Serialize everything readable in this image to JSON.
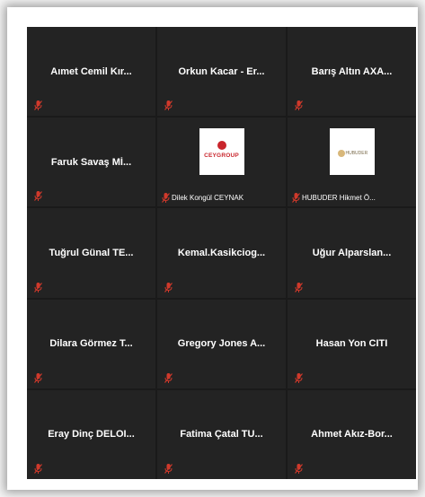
{
  "tiles": [
    {
      "name": "Aımet Cemil Kır..."
    },
    {
      "name": "Orkun Kacar - Er..."
    },
    {
      "name": "Barış Altın AXA..."
    },
    {
      "name": "Faruk Savaş Mİ..."
    },
    {
      "video_label": "Dilek Kongül CEYNAK",
      "logo": "CEYGROUP"
    },
    {
      "video_label": "HUBUDER Hikmet Ö...",
      "logo": "HUBUDER"
    },
    {
      "name": "Tuğrul Günal TE..."
    },
    {
      "name": "Kemal.Kasikciog..."
    },
    {
      "name": "Uğur Alparslan..."
    },
    {
      "name": "Dilara Görmez T..."
    },
    {
      "name": "Gregory Jones A..."
    },
    {
      "name": "Hasan Yon CITI"
    },
    {
      "name": "Eray Dinç DELOI..."
    },
    {
      "name": "Fatima Çatal TU..."
    },
    {
      "name": "Ahmet Akız-Bor..."
    }
  ],
  "colors": {
    "tile_bg": "#232323",
    "mute_icon": "#d0392b",
    "name_text": "#ffffff"
  },
  "icons": {
    "mute": "microphone-muted-icon"
  }
}
